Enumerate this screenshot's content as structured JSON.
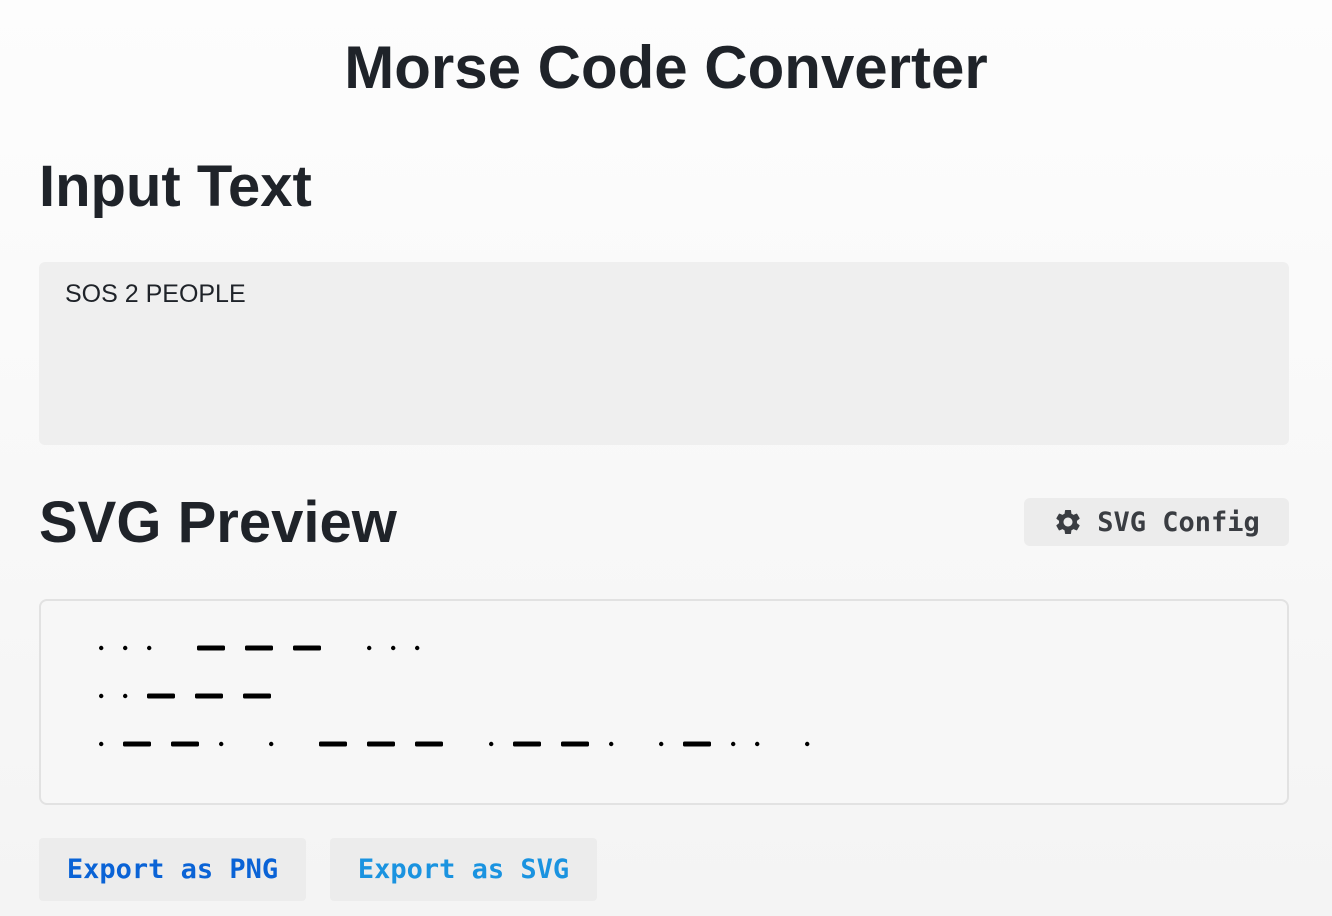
{
  "title": "Morse Code Converter",
  "input_section": {
    "heading": "Input Text",
    "value": "SOS 2 PEOPLE"
  },
  "preview_section": {
    "heading": "SVG Preview",
    "config_button_label": "SVG Config",
    "config_icon": "gear-icon",
    "morse_lines": [
      "... --- ...",
      "..---",
      ".--. . --- .--. .-.. ."
    ]
  },
  "export": {
    "png_label": "Export as PNG",
    "svg_label": "Export as SVG"
  },
  "colors": {
    "png_button_text": "#0a63d6",
    "svg_button_text": "#1a93e0",
    "morse_ink": "#000000"
  }
}
